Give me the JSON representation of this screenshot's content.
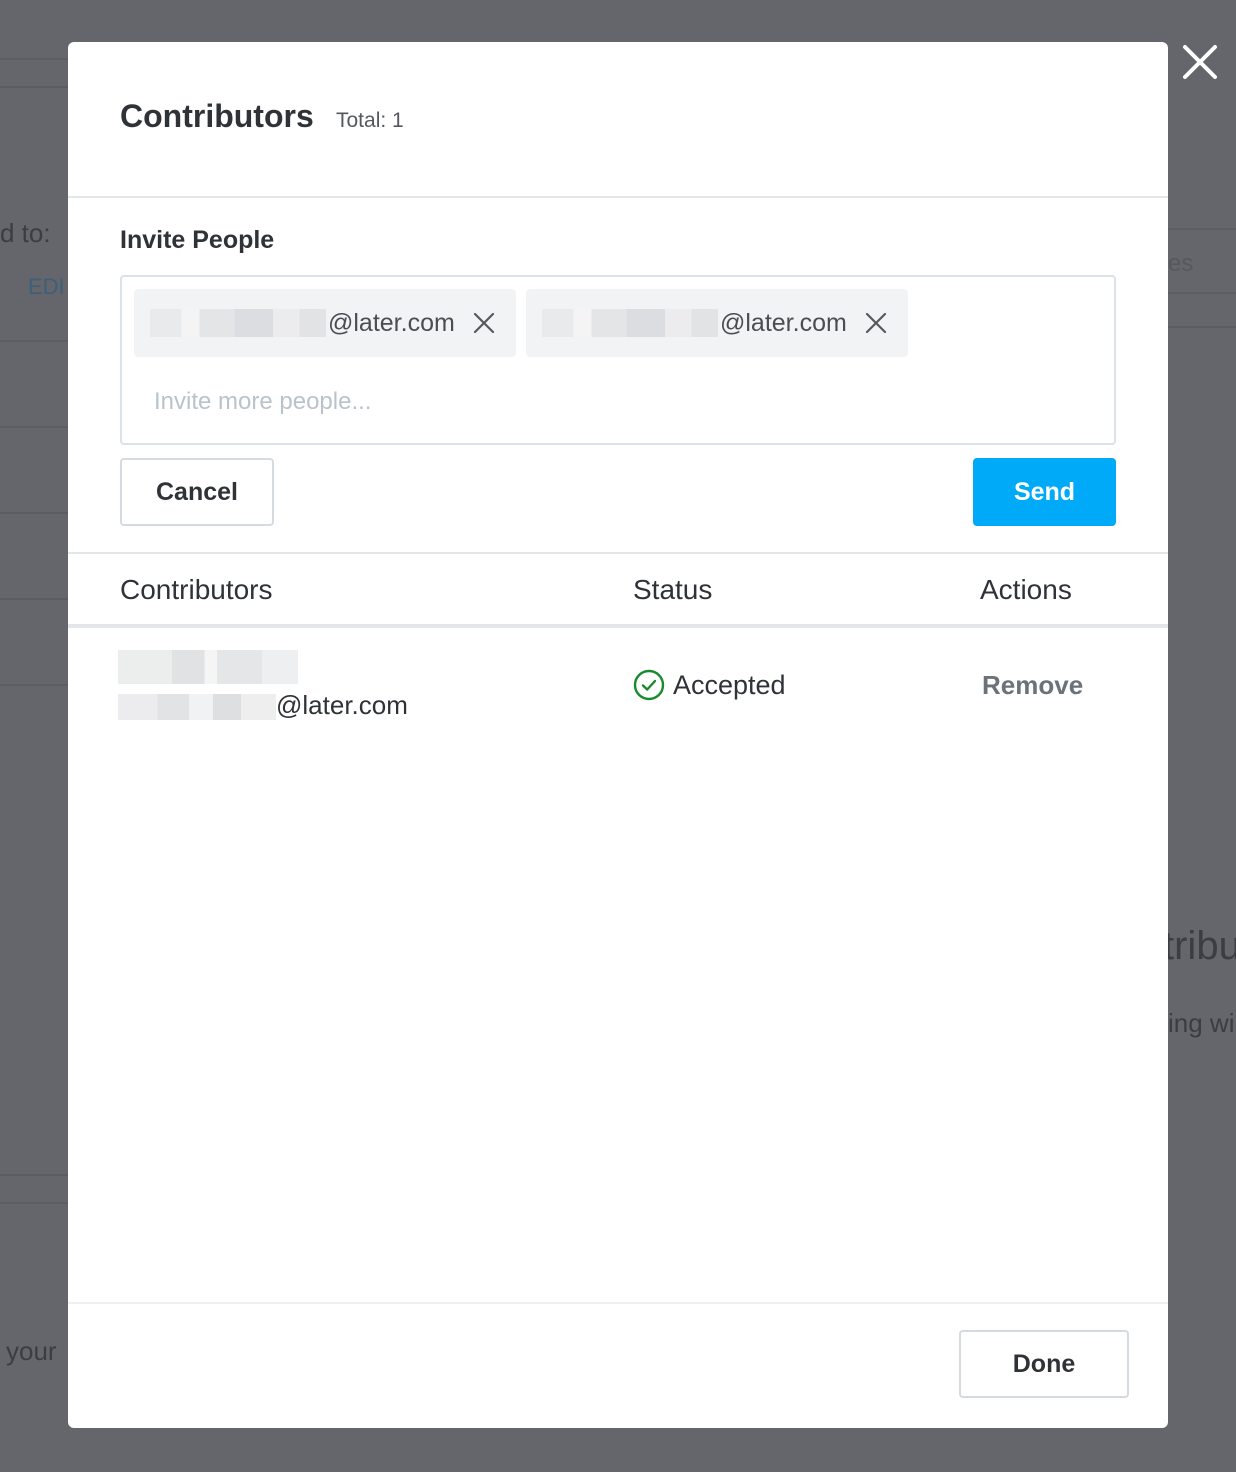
{
  "background": {
    "fragments": [
      "d to:",
      "EDI",
      "es",
      "tribu",
      "ing wi",
      "your"
    ]
  },
  "modal": {
    "title": "Contributors",
    "total": "Total: 1",
    "invite": {
      "label": "Invite People",
      "chips": [
        {
          "domain": "@later.com"
        },
        {
          "domain": "@later.com"
        }
      ],
      "placeholder": "Invite more people..."
    },
    "buttons": {
      "cancel": "Cancel",
      "send": "Send",
      "done": "Done"
    },
    "table": {
      "headers": [
        "Contributors",
        "Status",
        "Actions"
      ],
      "rows": [
        {
          "email_domain": "@later.com",
          "status": "Accepted",
          "action": "Remove"
        }
      ]
    }
  },
  "colors": {
    "accent": "#00aaf8",
    "status_accepted": "#1a8a2e",
    "overlay": "#64666c"
  },
  "icons": [
    "close-icon",
    "remove-chip-icon",
    "check-circle-icon"
  ]
}
